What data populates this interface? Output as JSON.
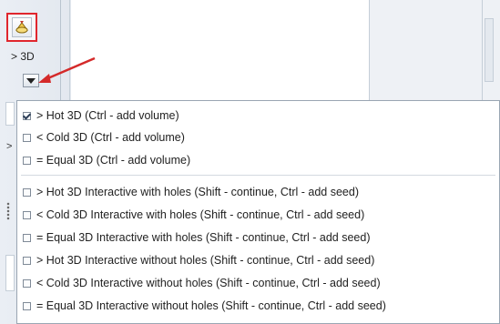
{
  "toolbar": {
    "tool_icon": "3d-segmentation-icon",
    "label": "> 3D",
    "dropdown_icon": "chevron-down-icon",
    "highlight_color": "#e0262d"
  },
  "annotation": {
    "arrow_color": "#d42a2a"
  },
  "background": {
    "left_glyph": ">"
  },
  "menu": {
    "items": [
      {
        "label": "> Hot 3D (Ctrl - add volume)",
        "checked": true
      },
      {
        "label": "< Cold 3D (Ctrl - add volume)",
        "checked": false
      },
      {
        "label": "= Equal 3D (Ctrl - add volume)",
        "checked": false
      },
      {
        "label": "> Hot 3D Interactive with holes (Shift - continue, Ctrl - add seed)",
        "checked": false
      },
      {
        "label": "< Cold 3D Interactive with holes (Shift - continue, Ctrl - add seed)",
        "checked": false
      },
      {
        "label": "= Equal 3D Interactive with holes (Shift - continue, Ctrl - add seed)",
        "checked": false
      },
      {
        "label": "> Hot 3D Interactive without holes (Shift - continue, Ctrl - add seed)",
        "checked": false
      },
      {
        "label": "< Cold 3D Interactive without holes (Shift - continue, Ctrl - add seed)",
        "checked": false
      },
      {
        "label": "= Equal 3D Interactive without holes (Shift - continue, Ctrl - add seed)",
        "checked": false
      }
    ]
  }
}
